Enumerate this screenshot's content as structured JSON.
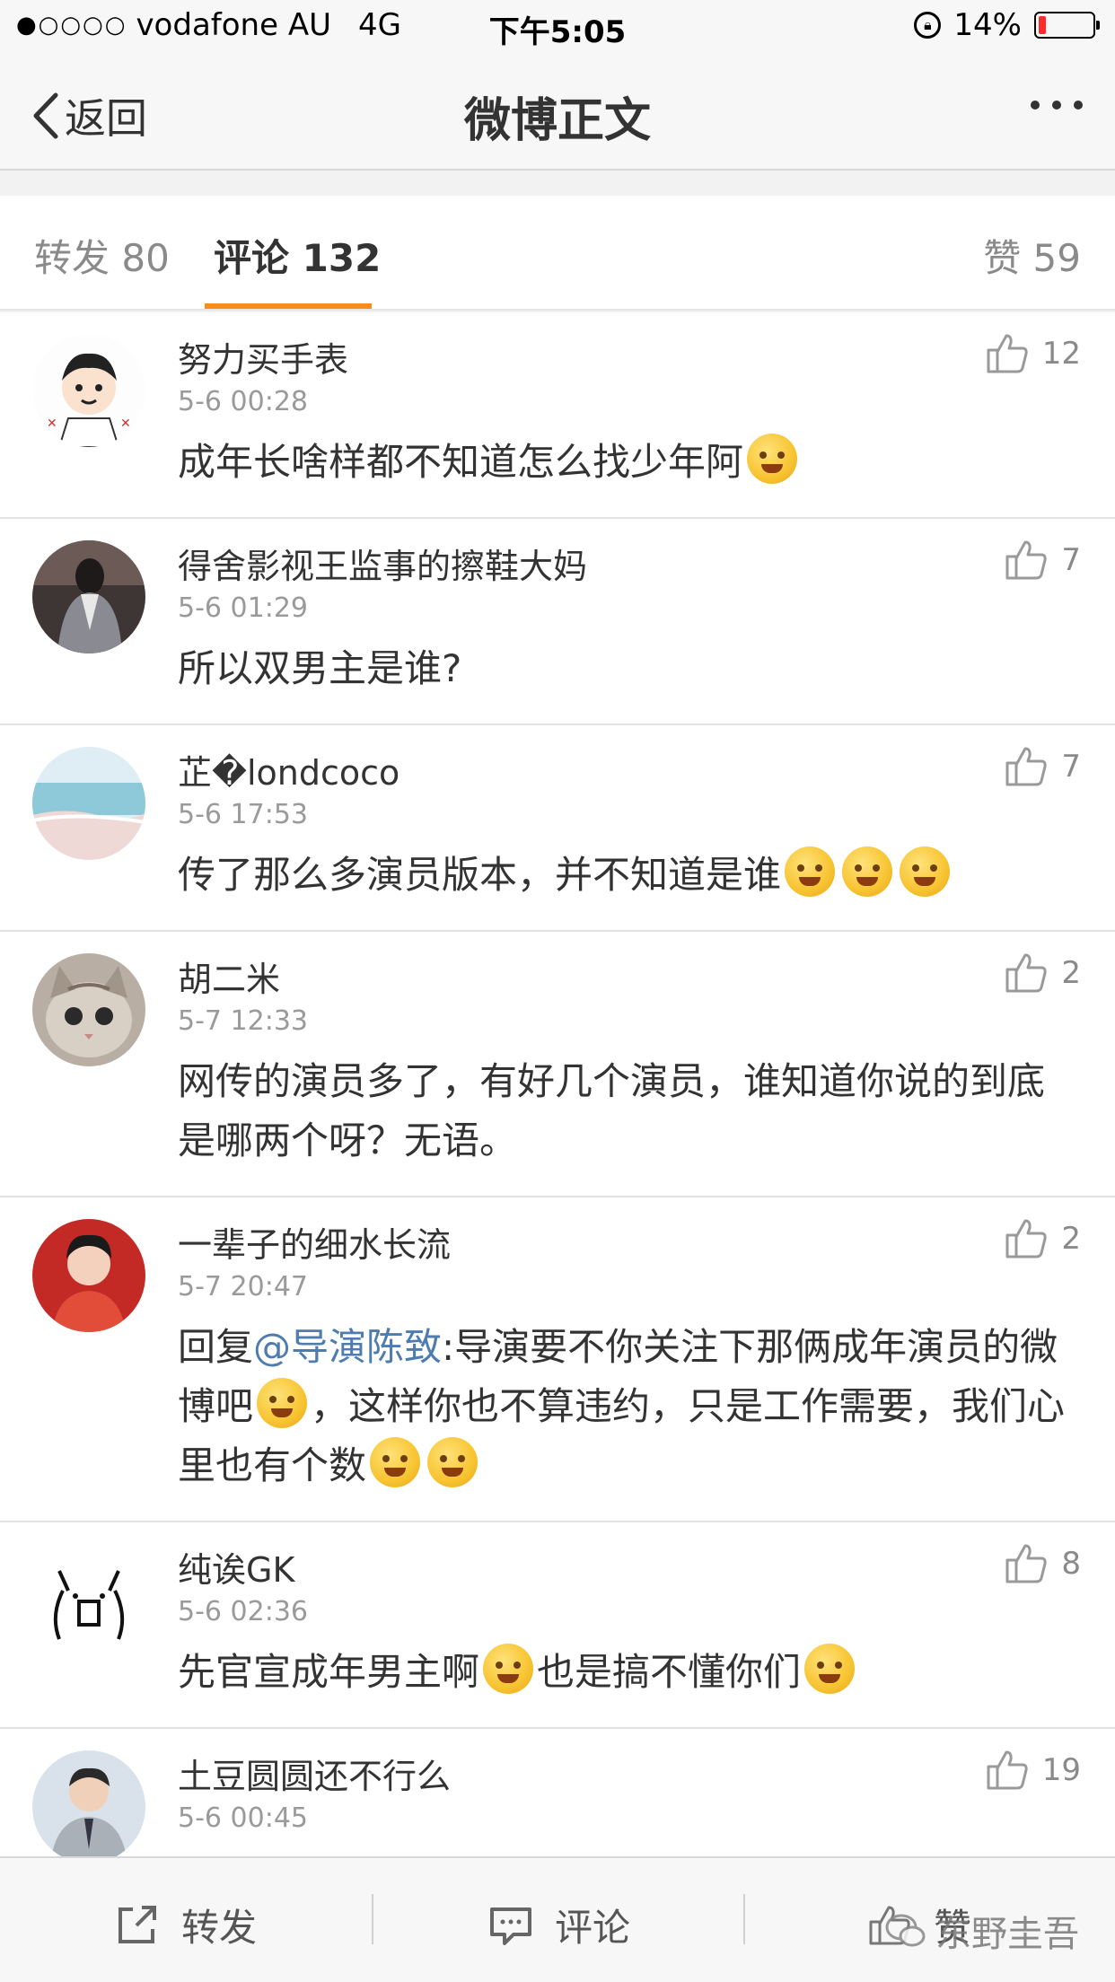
{
  "status_bar": {
    "signal": "●○○○○",
    "carrier": "vodafone AU",
    "network": "4G",
    "time": "下午5:05",
    "battery": "14%"
  },
  "nav": {
    "back_label": "返回",
    "title": "微博正文"
  },
  "tabs": [
    {
      "label": "转发 80"
    },
    {
      "label": "评论 132"
    },
    {
      "label": "赞 59"
    }
  ],
  "comments": [
    {
      "name": "努力买手表",
      "time": "5-6 00:28",
      "likes": "12",
      "text": "成年长啥样都不知道怎么找少年阿"
    },
    {
      "name": "得舍影视王监事的擦鞋大妈",
      "time": "5-6 01:29",
      "likes": "7",
      "text": "所以双男主是谁?"
    },
    {
      "name": "芷�londcoco",
      "time": "5-6 17:53",
      "likes": "7",
      "text": "传了那么多演员版本，并不知道是谁"
    },
    {
      "name": "胡二米",
      "time": "5-7 12:33",
      "likes": "2",
      "text": "网传的演员多了，有好几个演员，谁知道你说的到底是哪两个呀？无语。"
    },
    {
      "name": "一辈子的细水长流",
      "time": "5-7 20:47",
      "likes": "2",
      "text_prefix": "回复",
      "mention": "@导演陈致",
      "text_a": ":导演要不你关注下那俩成年演员的微博吧",
      "text_b": "，这样你也不算违约，只是工作需要，我们心里也有个数"
    },
    {
      "name": "纯诶GK",
      "time": "5-6 02:36",
      "likes": "8",
      "text_a": "先官宣成年男主啊",
      "text_b": "也是搞不懂你们"
    },
    {
      "name": "土豆圆圆还不行么",
      "time": "5-6 00:45",
      "likes": "19",
      "text": ""
    }
  ],
  "toolbar": {
    "repost": "转发",
    "comment": "评论",
    "like": "赞",
    "watermark": "东野圭吾"
  },
  "colors": {
    "accent": "#f68e1e",
    "mention": "#4f7cae",
    "battery_low": "#ff2b2b"
  }
}
